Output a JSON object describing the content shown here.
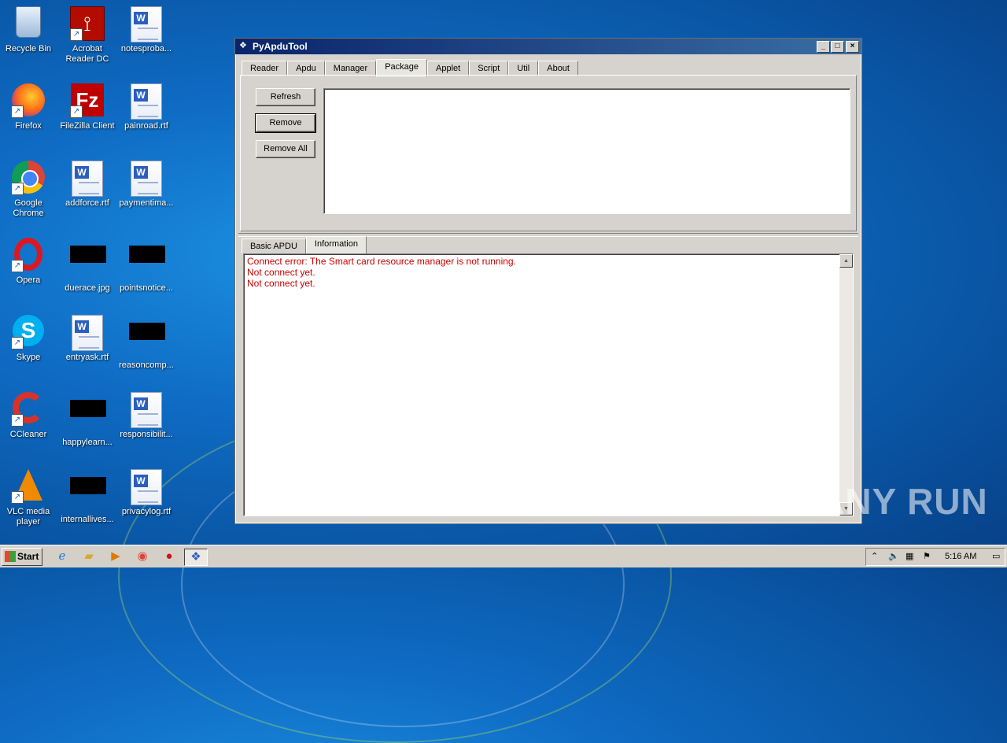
{
  "desktop": {
    "icons": [
      {
        "label": "Recycle Bin",
        "icon": "recycle-bin-icon"
      },
      {
        "label": "Acrobat Reader DC",
        "icon": "acrobat-icon"
      },
      {
        "label": "notesproba...",
        "icon": "word-doc-icon"
      },
      {
        "label": "Firefox",
        "icon": "firefox-icon"
      },
      {
        "label": "FileZilla Client",
        "icon": "filezilla-icon"
      },
      {
        "label": "painroad.rtf",
        "icon": "word-doc-icon"
      },
      {
        "label": "Google Chrome",
        "icon": "chrome-icon"
      },
      {
        "label": "addforce.rtf",
        "icon": "word-doc-icon"
      },
      {
        "label": "paymentima...",
        "icon": "word-doc-icon"
      },
      {
        "label": "Opera",
        "icon": "opera-icon"
      },
      {
        "label": "duerace.jpg",
        "icon": "image-file-icon"
      },
      {
        "label": "pointsnotice...",
        "icon": "image-file-icon"
      },
      {
        "label": "Skype",
        "icon": "skype-icon"
      },
      {
        "label": "entryask.rtf",
        "icon": "word-doc-icon"
      },
      {
        "label": "reasoncomp...",
        "icon": "image-file-icon"
      },
      {
        "label": "CCleaner",
        "icon": "ccleaner-icon"
      },
      {
        "label": "happylearn...",
        "icon": "image-file-icon"
      },
      {
        "label": "responsibilit...",
        "icon": "word-doc-icon"
      },
      {
        "label": "VLC media player",
        "icon": "vlc-icon"
      },
      {
        "label": "internallives...",
        "icon": "image-file-icon"
      },
      {
        "label": "privacylog.rtf",
        "icon": "word-doc-icon"
      }
    ]
  },
  "window": {
    "title": "PyApduTool",
    "controls": {
      "minimize": "_",
      "maximize": "□",
      "close": "×"
    },
    "tabs": [
      "Reader",
      "Apdu",
      "Manager",
      "Package",
      "Applet",
      "Script",
      "Util",
      "About"
    ],
    "active_tab": "Package",
    "package": {
      "refresh_label": "Refresh",
      "remove_label": "Remove",
      "remove_all_label": "Remove All"
    },
    "bottom_tabs": [
      "Basic APDU",
      "Information"
    ],
    "active_bottom_tab": "Information",
    "log_lines": [
      "Connect error: The Smart card resource manager is not running.",
      "Not connect yet.",
      "Not connect yet."
    ],
    "log_color": "#cc0000"
  },
  "taskbar": {
    "start_label": "Start",
    "quick_launch": [
      "internet-explorer-icon",
      "folder-icon",
      "media-player-icon",
      "chrome-icon",
      "opera-icon",
      "pyapdutool-icon"
    ],
    "clock": "5:16 AM"
  },
  "watermark": "ANY RUN"
}
